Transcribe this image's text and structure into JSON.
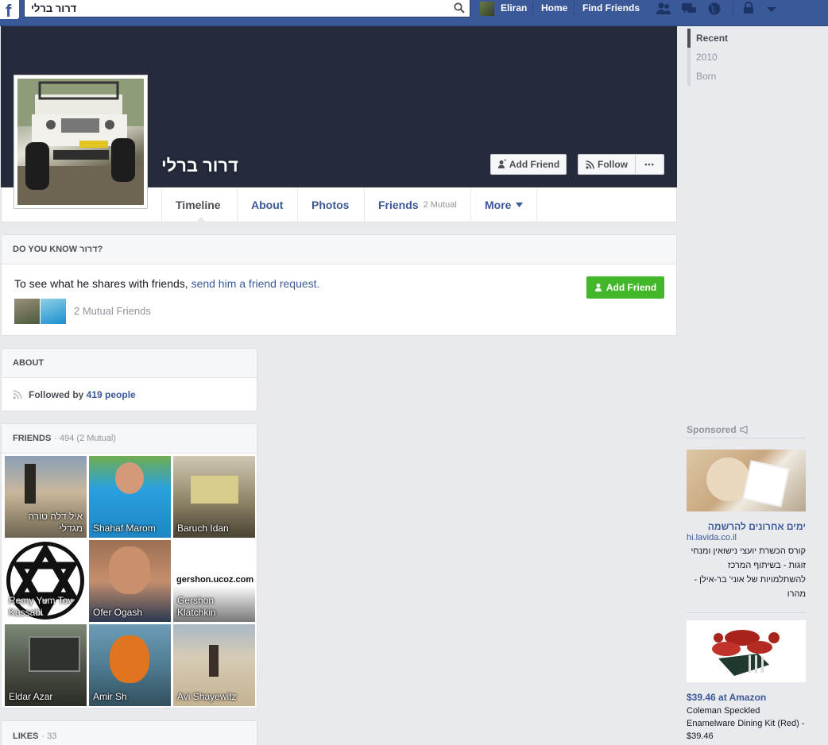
{
  "topbar": {
    "logo": "f",
    "search_value": "דרור ברלי",
    "user_name": "Eliran",
    "home": "Home",
    "find_friends": "Find Friends"
  },
  "profile": {
    "name": "דרור ברלי",
    "add_friend": "Add Friend",
    "follow": "Follow",
    "more_dots": "•••"
  },
  "tabs": [
    {
      "label": "Timeline"
    },
    {
      "label": "About"
    },
    {
      "label": "Photos"
    },
    {
      "label": "Friends",
      "sub": "2 Mutual"
    },
    {
      "label": "More"
    }
  ],
  "know_card": {
    "header": "DO YOU KNOW דרור?",
    "text": "To see what he shares with friends, ",
    "link": "send him a friend request.",
    "button": "Add Friend",
    "mutual": "2 Mutual Friends"
  },
  "about_card": {
    "header": "ABOUT",
    "followed_prefix": "Followed by ",
    "followed_link": "419 people"
  },
  "friends_card": {
    "header": "FRIENDS",
    "meta": "· 494 (2 Mutual)",
    "friends": [
      {
        "name": "איל דלה טורה מגדלי"
      },
      {
        "name": "Shahaf Marom"
      },
      {
        "name": "Baruch Idan"
      },
      {
        "name": "Remy Yum Tov Kassabi"
      },
      {
        "name": "Ofer Ogash"
      },
      {
        "name": "Gershon Klatchkin",
        "overlay": "gershon.ucoz.com"
      },
      {
        "name": "Eldar Azar"
      },
      {
        "name": "Amir Sh"
      },
      {
        "name": "Avi Shayewitz"
      }
    ]
  },
  "likes_card": {
    "header": "LIKES",
    "meta": "· 33"
  },
  "timeline_nav": [
    "Recent",
    "2010",
    "Born"
  ],
  "sponsored": {
    "label": "Sponsored",
    "ads": [
      {
        "title": "ימים אחרונים להרשמה",
        "domain": "hi.lavida.co.il",
        "body": "קורס הכשרת יועצי נישואין ומנחי זוגות - בשיתוף המרכז להשתלמויות של אוני' בר-אילן - מהרו"
      },
      {
        "title": "$39.46 at Amazon",
        "body": "Coleman Speckled Enamelware Dining Kit (Red) - $39.46"
      }
    ]
  },
  "colors": {
    "topbar": "#3b5998",
    "cover": "#252b3b",
    "link": "#3b5998",
    "green": "#42b72a"
  }
}
